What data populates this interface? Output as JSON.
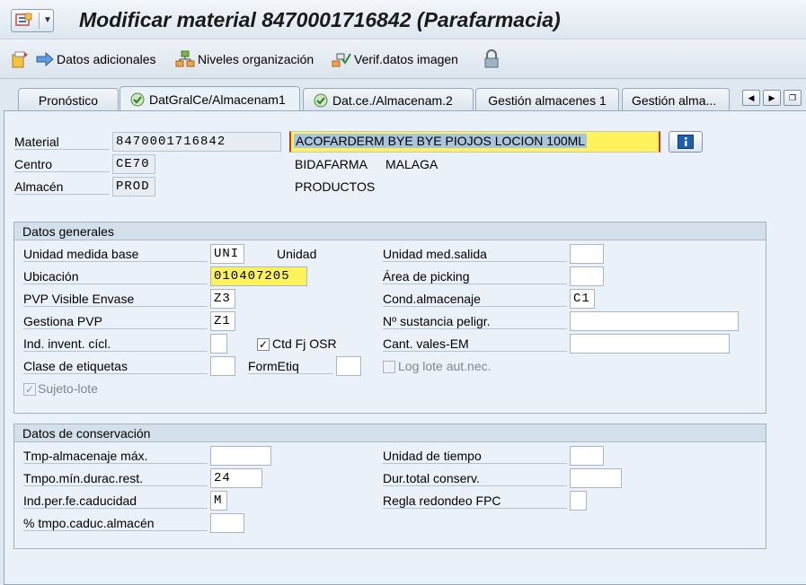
{
  "window": {
    "title": "Modificar material 8470001716842 (Parafarmacia)"
  },
  "toolbar": {
    "datos_adicionales": "Datos adicionales",
    "niveles_organizacion": "Niveles organización",
    "verif_datos_imagen": "Verif.datos imagen"
  },
  "tabs": [
    {
      "label": "Pronóstico",
      "checked": false,
      "active": false
    },
    {
      "label": "DatGralCe/Almacenam1",
      "checked": true,
      "active": true
    },
    {
      "label": "Dat.ce./Almacenam.2",
      "checked": true,
      "active": false
    },
    {
      "label": "Gestión almacenes 1",
      "checked": false,
      "active": false
    },
    {
      "label": "Gestión alma...",
      "checked": false,
      "active": false
    }
  ],
  "header": {
    "material_label": "Material",
    "material_value": "8470001716842",
    "material_desc": "ACOFARDERM BYE BYE PIOJOS LOCION 100ML",
    "centro_label": "Centro",
    "centro_value": "CE70",
    "centro_name": "BIDAFARMA",
    "centro_city": "MALAGA",
    "almacen_label": "Almacén",
    "almacen_value": "PROD",
    "almacen_name": "PRODUCTOS"
  },
  "datos_generales": {
    "title": "Datos generales",
    "unidad_medida_base_label": "Unidad medida base",
    "unidad_medida_base_value": "UNI",
    "unidad_medida_base_text": "Unidad",
    "ubicacion_label": "Ubicación",
    "ubicacion_value": "010407205",
    "pvp_visible_label": "PVP Visible Envase",
    "pvp_visible_value": "Z3",
    "gestiona_pvp_label": "Gestiona PVP",
    "gestiona_pvp_value": "Z1",
    "ind_invent_label": "Ind. invent. cícl.",
    "ind_invent_value": "",
    "ctd_fj_osr_label": "Ctd Fj OSR",
    "ctd_fj_osr_checked": true,
    "clase_etiquetas_label": "Clase de etiquetas",
    "clase_etiquetas_value": "",
    "formetiq_label": "FormEtiq",
    "formetiq_value": "",
    "sujeto_lote_label": "Sujeto-lote",
    "sujeto_lote_checked": true,
    "unidad_med_salida_label": "Unidad med.salida",
    "unidad_med_salida_value": "",
    "area_picking_label": "Área de picking",
    "area_picking_value": "",
    "cond_almacenaje_label": "Cond.almacenaje",
    "cond_almacenaje_value": "C1",
    "sustancia_peligr_label": "Nº sustancia peligr.",
    "sustancia_peligr_value": "",
    "cant_vales_label": "Cant. vales-EM",
    "cant_vales_value": "",
    "log_lote_label": "Log lote aut.nec.",
    "log_lote_checked": false
  },
  "datos_conservacion": {
    "title": "Datos de conservación",
    "tmp_almacenaje_label": "Tmp-almacenaje máx.",
    "tmp_almacenaje_value": "",
    "tmpo_min_label": "Tmpo.mín.durac.rest.",
    "tmpo_min_value": "24",
    "ind_per_label": "Ind.per.fe.caducidad",
    "ind_per_value": "M",
    "pct_tmpo_label": "% tmpo.caduc.almacén",
    "pct_tmpo_value": "",
    "unidad_tiempo_label": "Unidad de tiempo",
    "unidad_tiempo_value": "",
    "dur_total_label": "Dur.total conserv.",
    "dur_total_value": "",
    "regla_redondeo_label": "Regla redondeo FPC",
    "regla_redondeo_value": ""
  },
  "colors": {
    "background": "#dfe8f1",
    "highlight_yellow": "#fff35c",
    "selection_blue": "#a9c4dd"
  }
}
